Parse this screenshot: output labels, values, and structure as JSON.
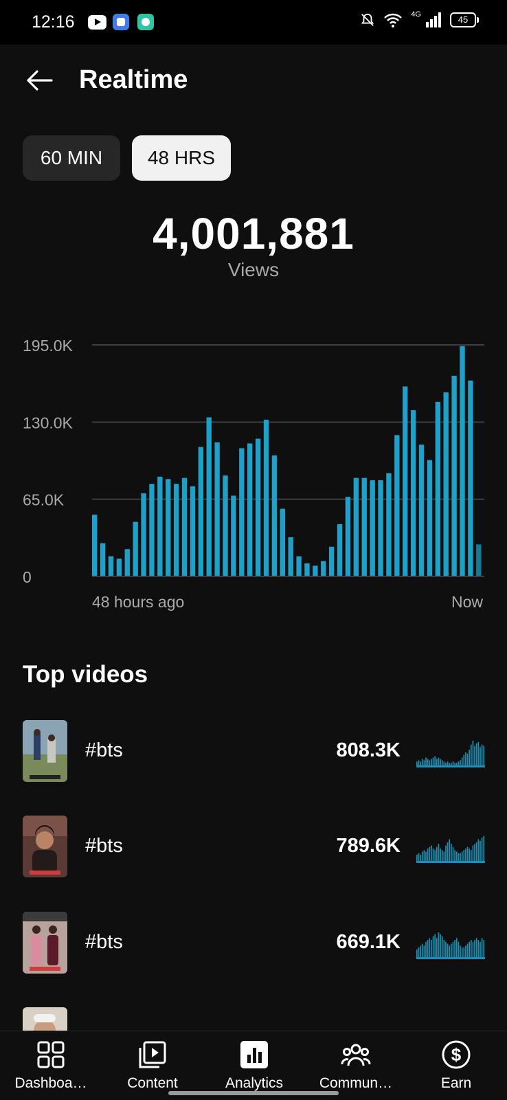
{
  "status_bar": {
    "time": "12:16",
    "network": "4G",
    "battery": "45"
  },
  "header": {
    "title": "Realtime"
  },
  "range_tabs": [
    {
      "label": "60 MIN",
      "selected": false
    },
    {
      "label": "48 HRS",
      "selected": true
    }
  ],
  "summary": {
    "views_value": "4,001,881",
    "views_label": "Views"
  },
  "chart_data": {
    "type": "bar",
    "title": "",
    "xlabel": "",
    "ylabel": "",
    "x_start_label": "48 hours ago",
    "x_end_label": "Now",
    "y_ticks": [
      "0",
      "65.0K",
      "130.0K",
      "195.0K"
    ],
    "ylim": [
      0,
      195000
    ],
    "grid": true,
    "bar_color": "#1ea0c8",
    "current_bar_color": "#157a93",
    "values": [
      52000,
      28000,
      17000,
      15000,
      23000,
      46000,
      70000,
      78000,
      84000,
      82000,
      78000,
      83000,
      76000,
      109000,
      134000,
      113000,
      85000,
      68000,
      108000,
      112000,
      116000,
      132000,
      102000,
      57000,
      33000,
      17000,
      11000,
      9000,
      13000,
      25000,
      44000,
      67000,
      83000,
      83000,
      81000,
      81000,
      87000,
      119000,
      160000,
      140000,
      111000,
      98000,
      147000,
      155000,
      169000,
      194000,
      165000,
      27000
    ]
  },
  "top_videos": {
    "title": "Top videos",
    "items": [
      {
        "title": "#bts",
        "views": "808.3K",
        "spark": [
          3,
          4,
          3,
          5,
          4,
          6,
          5,
          4,
          5,
          6,
          7,
          5,
          6,
          5,
          4,
          3,
          2,
          3,
          2,
          2,
          3,
          2,
          2,
          3,
          4,
          6,
          8,
          10,
          9,
          12,
          16,
          19,
          15,
          17,
          18,
          14,
          16,
          15
        ]
      },
      {
        "title": "#bts",
        "views": "789.6K",
        "spark": [
          4,
          5,
          4,
          6,
          7,
          6,
          8,
          9,
          10,
          8,
          7,
          9,
          11,
          8,
          7,
          6,
          10,
          12,
          14,
          11,
          9,
          7,
          6,
          5,
          5,
          6,
          7,
          8,
          9,
          8,
          7,
          10,
          11,
          12,
          14,
          13,
          15,
          16
        ]
      },
      {
        "title": "#bts",
        "views": "669.1K",
        "spark": [
          4,
          5,
          6,
          7,
          6,
          8,
          9,
          10,
          9,
          11,
          12,
          10,
          13,
          12,
          11,
          9,
          8,
          7,
          6,
          7,
          8,
          9,
          10,
          8,
          6,
          5,
          5,
          6,
          7,
          8,
          9,
          8,
          9,
          10,
          9,
          8,
          10,
          9
        ]
      }
    ]
  },
  "bottom_nav": [
    {
      "label": "Dashboa…",
      "icon": "dashboard-icon",
      "active": false
    },
    {
      "label": "Content",
      "icon": "content-icon",
      "active": false
    },
    {
      "label": "Analytics",
      "icon": "analytics-icon",
      "active": true
    },
    {
      "label": "Commun…",
      "icon": "community-icon",
      "active": false
    },
    {
      "label": "Earn",
      "icon": "earn-icon",
      "active": false
    }
  ]
}
